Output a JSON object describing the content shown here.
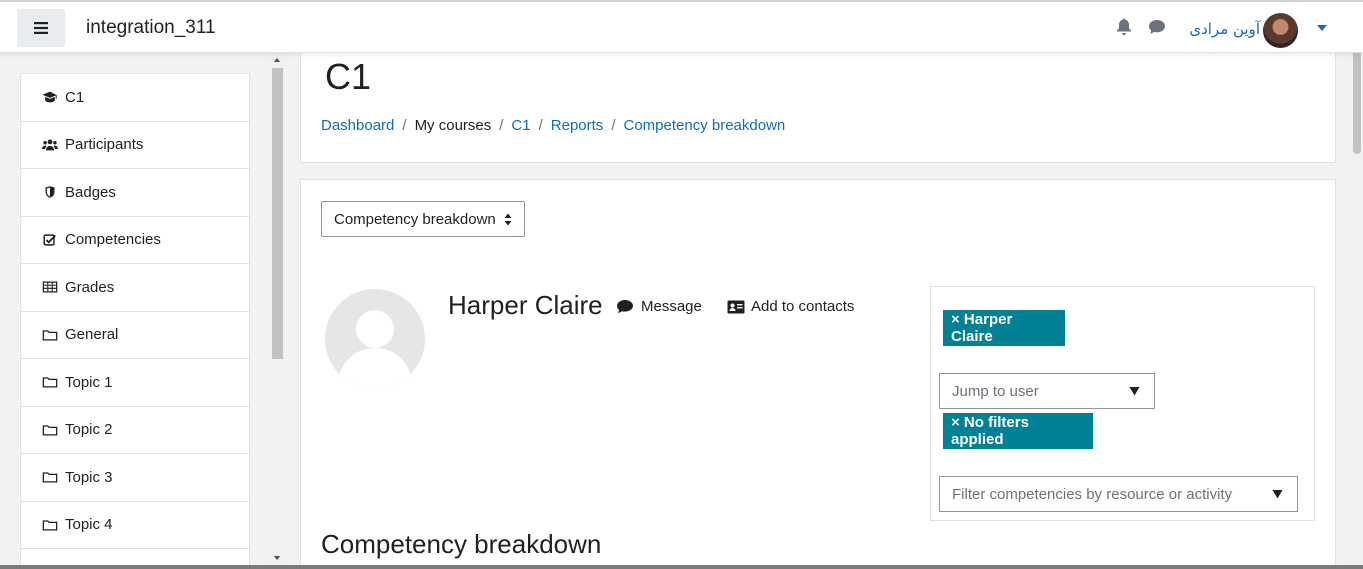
{
  "navbar": {
    "site_name": "integration_311",
    "username": "آوین مرادی"
  },
  "sidebar": {
    "items": [
      {
        "label": "C1",
        "icon": "graduation-cap-icon"
      },
      {
        "label": "Participants",
        "icon": "users-icon"
      },
      {
        "label": "Badges",
        "icon": "shield-icon"
      },
      {
        "label": "Competencies",
        "icon": "check-square-icon"
      },
      {
        "label": "Grades",
        "icon": "table-icon"
      },
      {
        "label": "General",
        "icon": "folder-icon"
      },
      {
        "label": "Topic 1",
        "icon": "folder-icon"
      },
      {
        "label": "Topic 2",
        "icon": "folder-icon"
      },
      {
        "label": "Topic 3",
        "icon": "folder-icon"
      },
      {
        "label": "Topic 4",
        "icon": "folder-icon"
      }
    ]
  },
  "header": {
    "title": "C1",
    "breadcrumb": [
      "Dashboard",
      "My courses",
      "C1",
      "Reports",
      "Competency breakdown"
    ]
  },
  "report": {
    "selector_value": "Competency breakdown",
    "user_name": "Harper Claire",
    "message_label": "Message",
    "add_contacts_label": "Add to contacts",
    "selected_user_chip": "× Harper Claire",
    "jump_to_user_placeholder": "Jump to user",
    "filters_chip": "× No filters applied",
    "filter_placeholder": "Filter competencies by resource or activity",
    "section_heading": "Competency breakdown"
  },
  "colors": {
    "link": "#0f6cbf",
    "chip": "#008196"
  }
}
